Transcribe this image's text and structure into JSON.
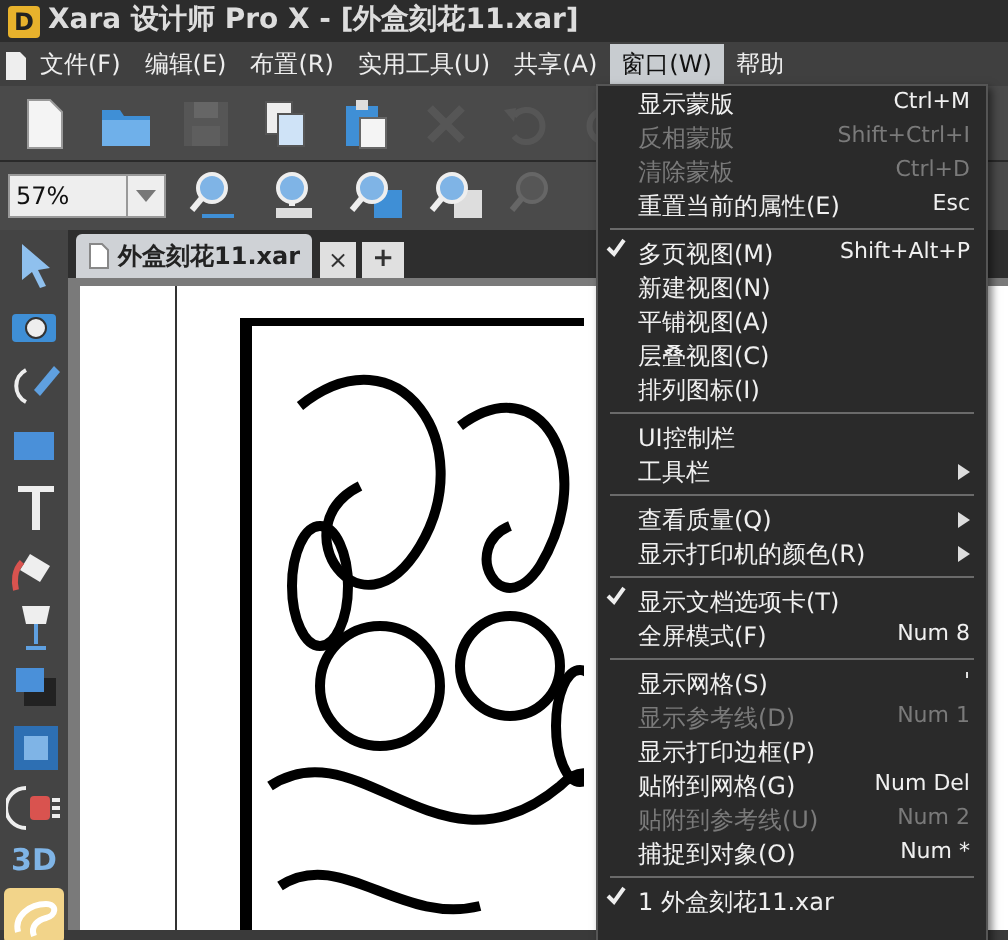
{
  "window": {
    "logo": "D",
    "title": "Xara 设计师 Pro X - [外盒刻花11.xar]"
  },
  "menu_bar": [
    {
      "label": "文件(F)",
      "selected": false
    },
    {
      "label": "编辑(E)",
      "selected": false
    },
    {
      "label": "布置(R)",
      "selected": false
    },
    {
      "label": "实用工具(U)",
      "selected": false
    },
    {
      "label": "共享(A)",
      "selected": false
    },
    {
      "label": "窗口(W)",
      "selected": true
    },
    {
      "label": "帮助",
      "selected": false
    }
  ],
  "toolbar": [
    {
      "kind": "new",
      "disabled": false
    },
    {
      "kind": "open",
      "disabled": false
    },
    {
      "kind": "save",
      "disabled": true
    },
    {
      "kind": "copy",
      "disabled": false
    },
    {
      "kind": "paste",
      "disabled": false
    },
    {
      "kind": "delete",
      "disabled": true
    },
    {
      "kind": "undo",
      "disabled": true
    },
    {
      "kind": "redo",
      "disabled": true
    }
  ],
  "zoom_bar": {
    "value": "57%",
    "buttons": [
      {
        "kind": "zoom-pan",
        "disabled": false
      },
      {
        "kind": "zoom-100",
        "disabled": false
      },
      {
        "kind": "zoom-page",
        "disabled": false
      },
      {
        "kind": "zoom-drawing",
        "disabled": false
      },
      {
        "kind": "zoom-previous",
        "disabled": true
      }
    ]
  },
  "tools": [
    {
      "kind": "selector",
      "selected": false
    },
    {
      "kind": "photo",
      "selected": false
    },
    {
      "kind": "pen",
      "selected": false
    },
    {
      "kind": "rectangle",
      "selected": false
    },
    {
      "kind": "text",
      "selected": false
    },
    {
      "kind": "fill",
      "selected": false
    },
    {
      "kind": "transparency",
      "selected": false
    },
    {
      "kind": "shadow",
      "selected": false
    },
    {
      "kind": "bevel",
      "selected": false
    },
    {
      "kind": "contour",
      "selected": false
    },
    {
      "kind": "extrude",
      "label": "3D",
      "selected": false
    },
    {
      "kind": "freehand",
      "selected": true
    }
  ],
  "document_tabs": {
    "tab": {
      "label": "外盒刻花11.xar",
      "close": "×"
    },
    "add": "+"
  },
  "window_menu": [
    [
      {
        "label": "显示蒙版",
        "shortcut": "Ctrl+M",
        "disabled": false
      },
      {
        "label": "反相蒙版",
        "shortcut": "Shift+Ctrl+I",
        "disabled": true
      },
      {
        "label": "清除蒙板",
        "shortcut": "Ctrl+D",
        "disabled": true
      },
      {
        "label": "重置当前的属性(E)",
        "shortcut": "Esc",
        "disabled": false
      }
    ],
    [
      {
        "label": "多页视图(M)",
        "shortcut": "Shift+Alt+P",
        "checked": true
      },
      {
        "label": "新建视图(N)",
        "checked": false
      },
      {
        "label": "平铺视图(A)",
        "checked": false
      },
      {
        "label": "层叠视图(C)",
        "checked": false
      },
      {
        "label": "排列图标(I)",
        "checked": false
      }
    ],
    [
      {
        "label": "UI控制栏",
        "submenu": false
      },
      {
        "label": "工具栏",
        "submenu": true
      }
    ],
    [
      {
        "label": "查看质量(Q)",
        "submenu": true
      },
      {
        "label": "显示打印机的颜色(R)",
        "submenu": true
      }
    ],
    [
      {
        "label": "显示文档选项卡(T)",
        "checked": true
      },
      {
        "label": "全屏模式(F)",
        "shortcut": "Num 8",
        "checked": false
      }
    ],
    [
      {
        "label": "显示网格(S)",
        "shortcut": "'",
        "disabled": false
      },
      {
        "label": "显示参考线(D)",
        "shortcut": "Num 1",
        "disabled": true
      },
      {
        "label": "显示打印边框(P)",
        "disabled": false
      },
      {
        "label": "贴附到网格(G)",
        "shortcut": "Num Del",
        "disabled": false
      },
      {
        "label": "贴附到参考线(U)",
        "shortcut": "Num 2",
        "disabled": true
      },
      {
        "label": "捕捉到对象(O)",
        "shortcut": "Num *",
        "disabled": false
      }
    ],
    [
      {
        "label": "1 外盒刻花11.xar",
        "checked": true
      }
    ]
  ]
}
